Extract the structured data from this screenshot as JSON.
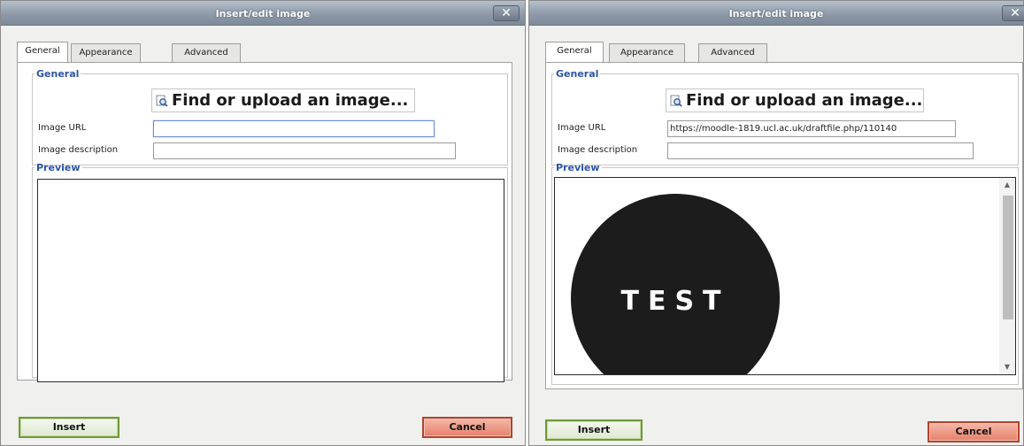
{
  "dialogs": [
    {
      "title": "Insert/edit image",
      "close_label": "✕",
      "tabs": [
        "General",
        "Appearance",
        "Advanced"
      ],
      "active_tab": "General",
      "general_legend": "General",
      "find_button_label": "Find or upload an image...",
      "image_url_label": "Image URL",
      "image_url_value": "",
      "image_description_label": "Image description",
      "image_description_value": "",
      "preview_legend": "Preview",
      "insert_label": "Insert",
      "cancel_label": "Cancel"
    },
    {
      "title": "Insert/edit image",
      "close_label": "✕",
      "tabs": [
        "General",
        "Appearance",
        "Advanced"
      ],
      "active_tab": "General",
      "general_legend": "General",
      "find_button_label": "Find or upload an image...",
      "image_url_label": "Image URL",
      "image_url_value": "https://moodle-1819.ucl.ac.uk/draftfile.php/110140",
      "image_description_label": "Image description",
      "image_description_value": "",
      "preview_legend": "Preview",
      "preview_image_text": "TEST",
      "insert_label": "Insert",
      "cancel_label": "Cancel"
    }
  ],
  "colors": {
    "legend": "#2b54a8",
    "insert_border": "#6f9b36",
    "cancel_fill": "#e4806a",
    "titlebar": "#8e9aa8"
  }
}
